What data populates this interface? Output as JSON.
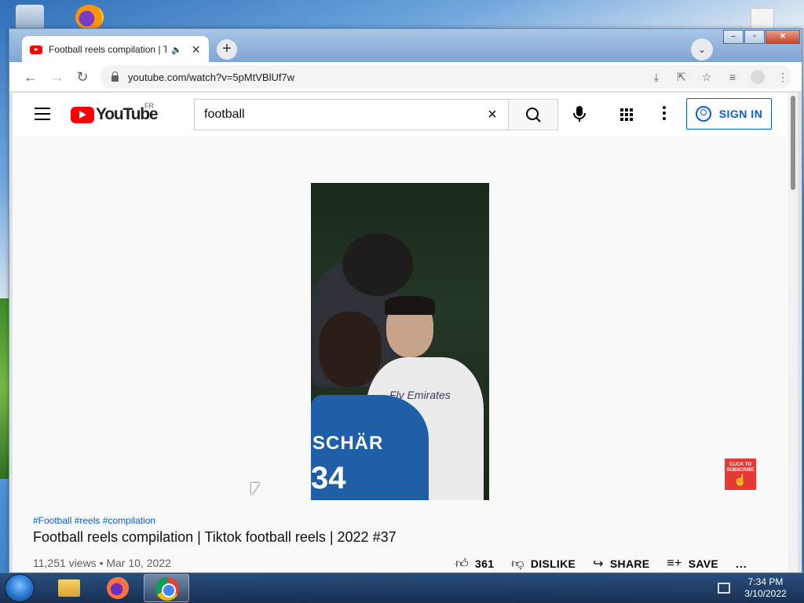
{
  "browser": {
    "tab_title": "Football reels compilation | T",
    "url": "youtube.com/watch?v=5pMtVBlUf7w",
    "tab_close": "✕",
    "new_tab": "+"
  },
  "youtube": {
    "logo_text": "YouTube",
    "country": "FR",
    "search_query": "football",
    "sign_in": "SIGN IN"
  },
  "video": {
    "overlay_text_b": "Fly Emirates",
    "overlay_text_c": "SCHÄR",
    "overlay_num_c": "34",
    "subscribe_badge": "CLICK TO SUBSCRIBE",
    "hashtags": "#Football #reels #compilation",
    "title": "Football reels compilation | Tiktok football reels | 2022 #37",
    "meta": "11,251 views • Mar 10, 2022",
    "likes": "361",
    "dislike": "DISLIKE",
    "share": "SHARE",
    "save": "SAVE",
    "more": "..."
  },
  "taskbar": {
    "time": "7:34 PM",
    "date": "3/10/2022"
  },
  "colors": {
    "youtube_red": "#ff0000",
    "link_blue": "#065fd4"
  }
}
